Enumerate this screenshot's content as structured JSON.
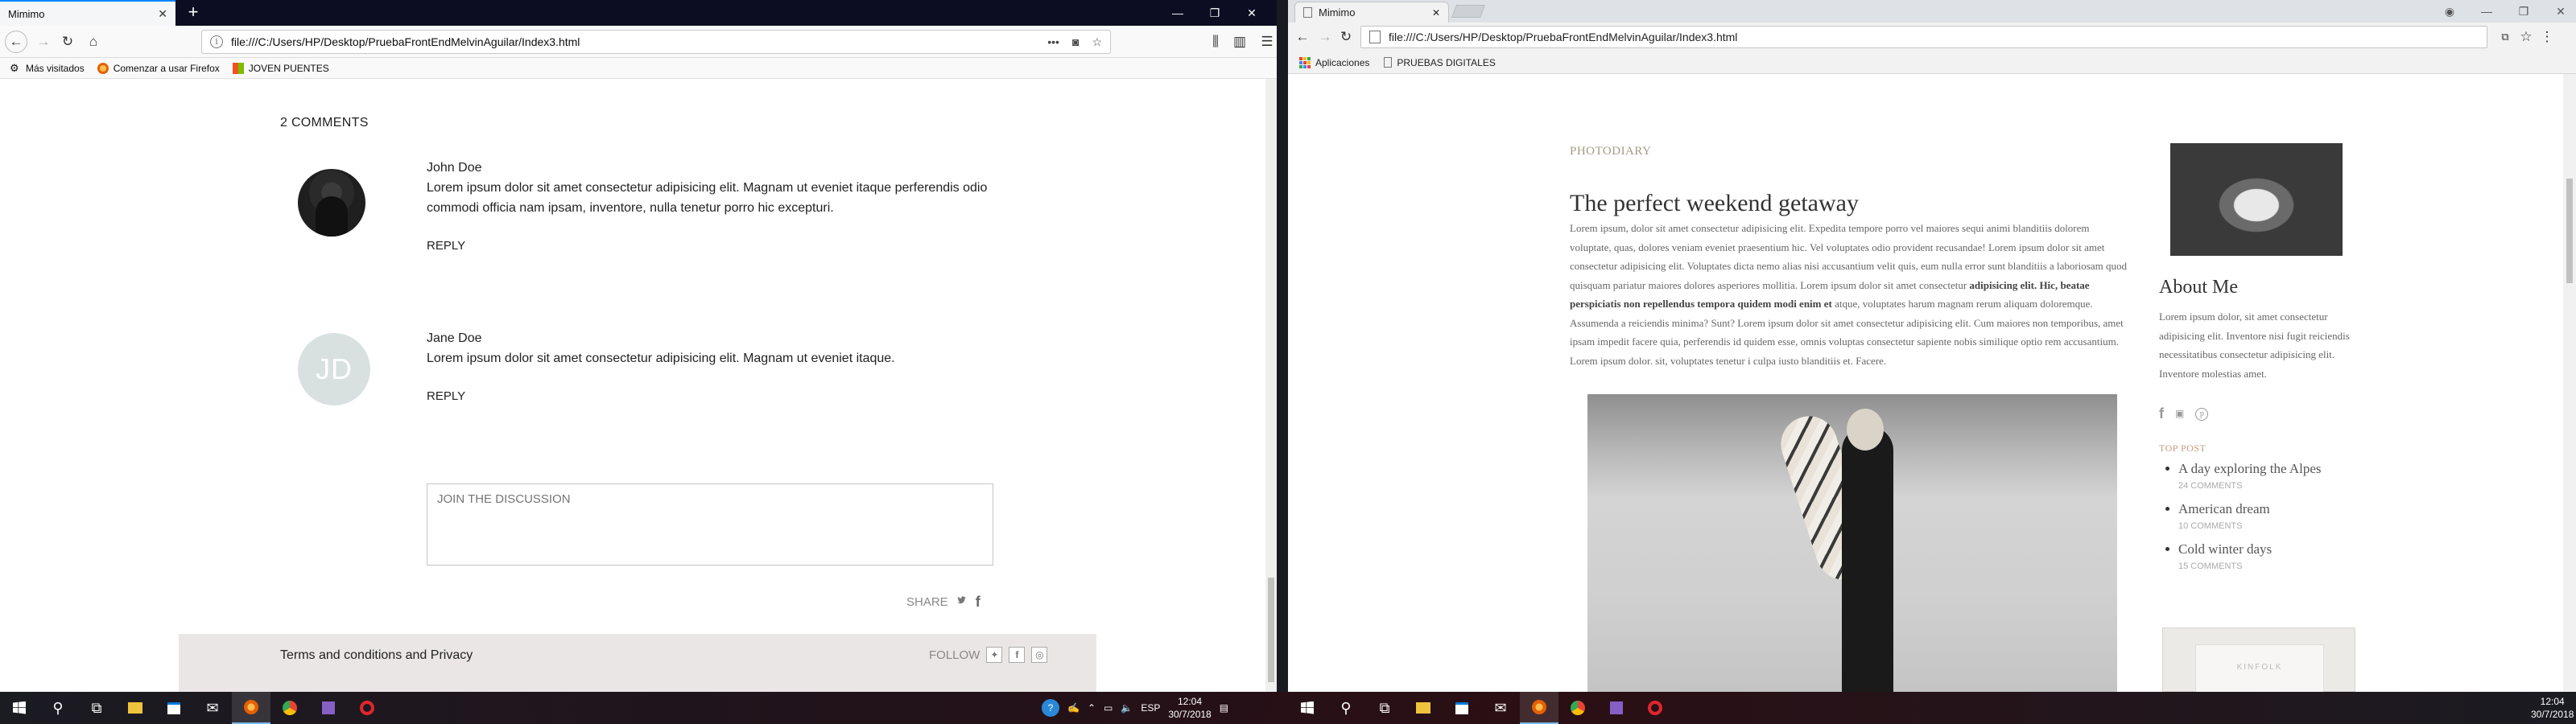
{
  "left_browser": {
    "tab_title": "Mimimo",
    "url": "file:///C:/Users/HP/Desktop/PruebaFrontEndMelvinAguilar/Index3.html",
    "bookmarks": [
      "Más visitados",
      "Comenzar a usar Firefox",
      "JOVEN PUENTES"
    ],
    "page": {
      "comments_heading": "2 COMMENTS",
      "comments": [
        {
          "name": "John Doe",
          "text": "Lorem ipsum dolor sit amet consectetur adipisicing elit. Magnam ut eveniet itaque perferendis odio commodi officia nam ipsam, inventore, nulla tenetur porro hic excepturi.",
          "reply_label": "REPLY",
          "avatar_type": "photo"
        },
        {
          "name": "Jane Doe",
          "initials": "JD",
          "text": "Lorem ipsum dolor sit amet consectetur adipisicing elit. Magnam ut eveniet itaque.",
          "reply_label": "REPLY",
          "avatar_type": "initials"
        }
      ],
      "discussion_placeholder": "JOIN THE DISCUSSION",
      "share_label": "SHARE",
      "footer_terms": "Terms and conditions and Privacy",
      "follow_label": "FOLLOW"
    }
  },
  "right_browser": {
    "tab_title": "Mimimo",
    "url": "file:///C:/Users/HP/Desktop/PruebaFrontEndMelvinAguilar/Index3.html",
    "bookmarks": [
      "Aplicaciones",
      "PRUEBAS DIGITALES"
    ],
    "page": {
      "category": "PHOTODIARY",
      "post_title": "The perfect weekend getaway",
      "post_text_1": "Lorem ipsum, dolor sit amet consectetur adipisicing elit. Expedita tempore porro vel maiores sequi animi blanditiis dolorem voluptate, quas, dolores veniam eveniet praesentium hic. Vel voluptates odio provident recusandae! Lorem ipsum dolor sit amet consectetur adipisicing elit. Voluptates dicta nemo alias nisi accusantium velit quis, eum nulla error sunt blanditiis a laboriosam quod quisquam pariatur maiores dolores asperiores mollitia. Lorem ipsum dolor sit amet consectetur",
      "post_text_bold": "adipisicing elit. Hic, beatae perspiciatis non repellendus tempora quidem modi enim et",
      "post_text_2": "atque, voluptates harum magnam rerum aliquam doloremque. Assumenda a reiciendis minima? Sunt? Lorem ipsum dolor sit amet consectetur adipisicing elit. Cum maiores non temporibus, amet ipsam impedit facere quia, perferendis id quidem esse, omnis voluptas consectetur sapiente nobis similique optio rem accusantium. Lorem ipsum dolor. sit, voluptates tenetur i culpa iusto blanditiis et. Facere.",
      "about_title": "About Me",
      "about_text": "Lorem ipsum dolor, sit amet consectetur adipisicing elit. Inventore nisi fugit reiciendis necessitatibus consectetur adipisicing elit. Inventore molestias amet.",
      "top_post_label": "TOP POST",
      "top_posts": [
        {
          "title": "A day exploring the Alpes",
          "meta": "24 COMMENTS"
        },
        {
          "title": "American dream",
          "meta": "10 COMMENTS"
        },
        {
          "title": "Cold winter days",
          "meta": "15 COMMENTS"
        }
      ],
      "magazine_label": "KINFOLK"
    }
  },
  "taskbar": {
    "left": {
      "language": "ESP",
      "time": "12:04",
      "date": "30/7/2018"
    },
    "right": {
      "time": "12:04",
      "date": "30/7/2018"
    }
  },
  "colors": {
    "firefox_tabbar": "#0c0c22",
    "accent_category": "#a39b83",
    "top_post_label": "#c49a7f",
    "footer_band": "#ebe6e6"
  }
}
